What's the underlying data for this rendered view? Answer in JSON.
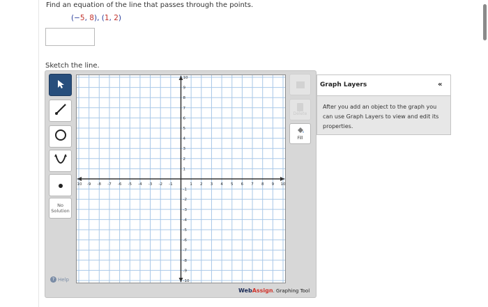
{
  "question": {
    "text": "Find an equation of the line that passes through the points.",
    "point_prefix_1": "(−",
    "point_x1": "5",
    "point_mid_1": ", ",
    "point_y1": "8",
    "point_mid_2": "), (",
    "point_x2": "1",
    "point_mid_3": ", ",
    "point_y2": "2",
    "point_suffix": ")"
  },
  "answer_input": {
    "value": ""
  },
  "sketch_label": "Sketch the line.",
  "toolbar": {
    "tools": [
      {
        "name": "select-tool",
        "icon": "arrow-pointer-icon",
        "active": true
      },
      {
        "name": "line-tool",
        "icon": "line-segment-icon",
        "active": false
      },
      {
        "name": "circle-tool",
        "icon": "circle-icon",
        "active": false
      },
      {
        "name": "parabola-tool",
        "icon": "parabola-icon",
        "active": false
      },
      {
        "name": "point-tool",
        "icon": "point-icon",
        "active": false
      }
    ],
    "no_solution_line1": "No",
    "no_solution_line2": "Solution",
    "help_label": "Help"
  },
  "right_toolbar": {
    "delete_label": "Delete",
    "fill_label": "Fill"
  },
  "graph": {
    "x_min": -10,
    "x_max": 10,
    "y_min": -10,
    "y_max": 10,
    "x_ticks": [
      "-10",
      "-9",
      "-8",
      "-7",
      "-6",
      "-5",
      "-4",
      "-3",
      "-2",
      "-1",
      "1",
      "2",
      "3",
      "4",
      "5",
      "6",
      "7",
      "8",
      "9",
      "10"
    ],
    "y_ticks": [
      "10",
      "9",
      "8",
      "7",
      "6",
      "5",
      "4",
      "3",
      "2",
      "1",
      "-1",
      "-2",
      "-3",
      "-4",
      "-5",
      "-6",
      "-7",
      "-8",
      "-9",
      "-10"
    ],
    "grid_color": "#a9c8e8",
    "axis_color": "#333333"
  },
  "brand": {
    "name_a": "Web",
    "name_b": "Assign",
    "suffix": ". Graphing Tool"
  },
  "layers_panel": {
    "title": "Graph Layers",
    "collapse_glyph": "«",
    "body": "After you add an object to the graph you can use Graph Layers to view and edit its properties."
  },
  "colors": {
    "active_tool": "#274e7c",
    "point_blue": "#2a3f9c",
    "point_red": "#c2332c",
    "brand_red": "#d0332a"
  }
}
